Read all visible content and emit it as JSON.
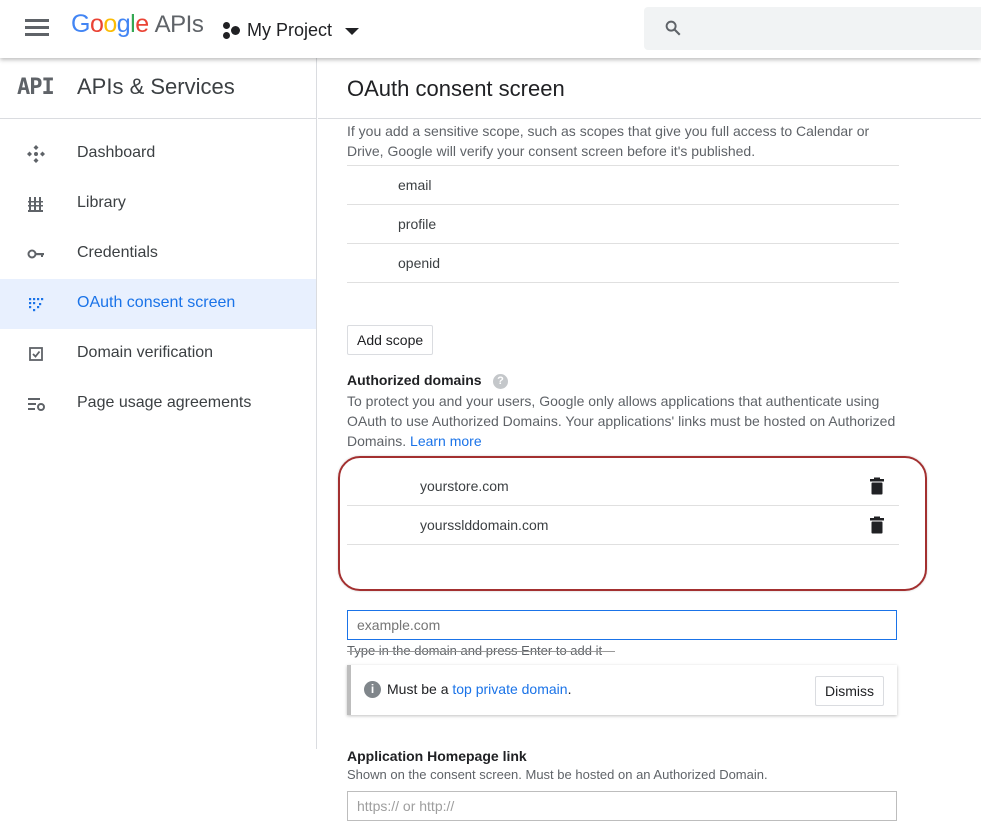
{
  "header": {
    "logo_google": [
      "G",
      "o",
      "o",
      "g",
      "l",
      "e"
    ],
    "logo_apis": "APIs",
    "project_name": "My Project"
  },
  "sidebar": {
    "api_badge": "API",
    "title": "APIs & Services",
    "items": [
      {
        "label": "Dashboard",
        "icon": "dashboard-icon"
      },
      {
        "label": "Library",
        "icon": "library-icon"
      },
      {
        "label": "Credentials",
        "icon": "key-icon"
      },
      {
        "label": "OAuth consent screen",
        "icon": "oauth-icon",
        "active": true
      },
      {
        "label": "Domain verification",
        "icon": "checkbox-icon"
      },
      {
        "label": "Page usage agreements",
        "icon": "settings-list-icon"
      }
    ]
  },
  "main": {
    "title": "OAuth consent screen",
    "sensitive_help": "If you add a sensitive scope, such as scopes that give you full access to Calendar or Drive, Google will verify your consent screen before it's published.",
    "scopes": [
      "email",
      "profile",
      "openid"
    ],
    "add_scope_label": "Add scope",
    "authorized_domains": {
      "title": "Authorized domains",
      "help_icon": "?",
      "description": "To protect you and your users, Google only allows applications that authenticate using OAuth to use Authorized Domains. Your applications' links must be hosted on Authorized Domains.",
      "learn_more": "Learn more",
      "domains": [
        "yourstore.com",
        "yoursslddomain.com"
      ],
      "input_placeholder": "example.com",
      "hint": "Type in the domain and press Enter to add it",
      "warning_prefix": "Must be a",
      "warning_link": "top private domain",
      "warning_suffix": ".",
      "dismiss_label": "Dismiss"
    },
    "homepage": {
      "title": "Application Homepage link",
      "description": "Shown on the consent screen. Must be hosted on an Authorized Domain.",
      "input_placeholder": "https:// or http://"
    }
  },
  "colors": {
    "accent": "#1a73e8",
    "active_bg": "#e8f0fe",
    "highlight_oval": "#a33030"
  }
}
